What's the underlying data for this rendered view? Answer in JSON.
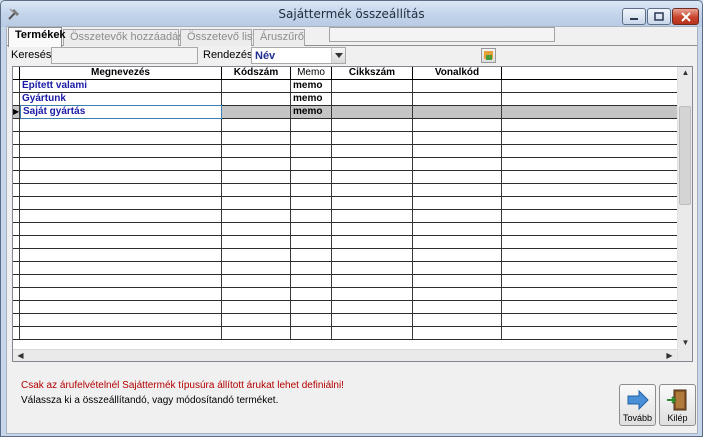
{
  "window": {
    "title": "Sajáttermék összeállítás"
  },
  "tabs": [
    {
      "label": "Termékek",
      "active": true
    },
    {
      "label": "Összetevők hozzáadása",
      "active": false
    },
    {
      "label": "Összetevő lista",
      "active": false
    },
    {
      "label": "Áruszűrő",
      "active": false
    }
  ],
  "toolbar": {
    "search_label": "Keresés:",
    "search_value": "",
    "sort_label": "Rendezés:",
    "sort_value": "Név"
  },
  "grid": {
    "columns": [
      "Megnevezés",
      "Kódszám",
      "Memo",
      "Cikkszám",
      "Vonalkód"
    ],
    "rows": [
      {
        "name": "Épített valami",
        "code": "",
        "memo": "memo",
        "sku": "",
        "barcode": ""
      },
      {
        "name": "Gyártunk",
        "code": "",
        "memo": "memo",
        "sku": "",
        "barcode": ""
      },
      {
        "name": "Saját gyártás",
        "code": "",
        "memo": "memo",
        "sku": "",
        "barcode": "",
        "selected": true
      }
    ]
  },
  "messages": {
    "warning": "Csak az árufelvételnél Sajáttermék típusúra állított árukat lehet definiálni!",
    "instruction": "Válassza ki a összeállítandó, vagy módosítandó terméket."
  },
  "buttons": {
    "next": "Tovább",
    "exit": "Kilép"
  },
  "colors": {
    "accent_text": "#1a1aa6",
    "warning_text": "#b30000",
    "selection_row": "#c5c5c5"
  },
  "icons": {
    "app": "tools-icon",
    "next": "arrow-right-icon",
    "exit": "door-exit-icon",
    "toolbar": "filter-icon"
  }
}
